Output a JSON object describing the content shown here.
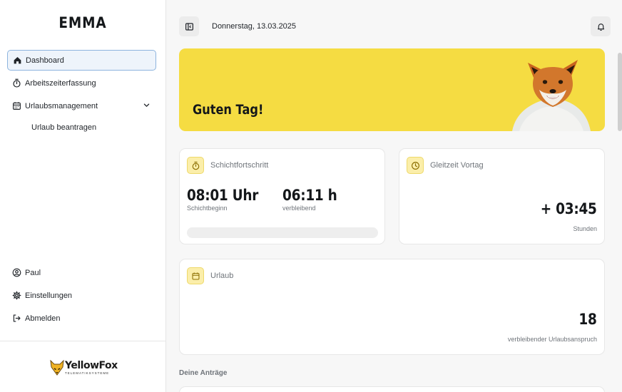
{
  "sidebar": {
    "brand": "EMMA",
    "nav": [
      {
        "label": "Dashboard",
        "icon": "home-icon",
        "active": true
      },
      {
        "label": "Arbeitszeiterfassung",
        "icon": "stopwatch-icon"
      },
      {
        "label": "Urlaubsmanagement",
        "icon": "calendar-icon",
        "expanded": true
      }
    ],
    "subnav": [
      {
        "label": "Urlaub beantragen"
      }
    ],
    "bottom": [
      {
        "label": "Paul",
        "icon": "user-circle-icon"
      },
      {
        "label": "Einstellungen",
        "icon": "gear-icon"
      },
      {
        "label": "Abmelden",
        "icon": "logout-icon"
      }
    ],
    "logo": {
      "name": "YellowFox",
      "tagline": "TELEMATIKSYSTEME"
    }
  },
  "header": {
    "date": "Donnerstag, 13.03.2025"
  },
  "hero": {
    "greeting": "Guten Tag!"
  },
  "shift": {
    "title": "Schichtfortschritt",
    "start_value": "08:01 Uhr",
    "start_label": "Schichtbeginn",
    "remaining_value": "06:11 h",
    "remaining_label": "verbleibend",
    "progress_fraction": 0
  },
  "flextime": {
    "title": "Gleitzeit Vortag",
    "value": "+ 03:45",
    "unit": "Stunden"
  },
  "vacation": {
    "title": "Urlaub",
    "value": "18",
    "label": "verbleibender Urlaubsanspruch"
  },
  "requests": {
    "title": "Deine Anträge"
  },
  "colors": {
    "accent": "#f5dc42",
    "active_border": "#8db4de",
    "active_bg": "#eef4fb"
  }
}
